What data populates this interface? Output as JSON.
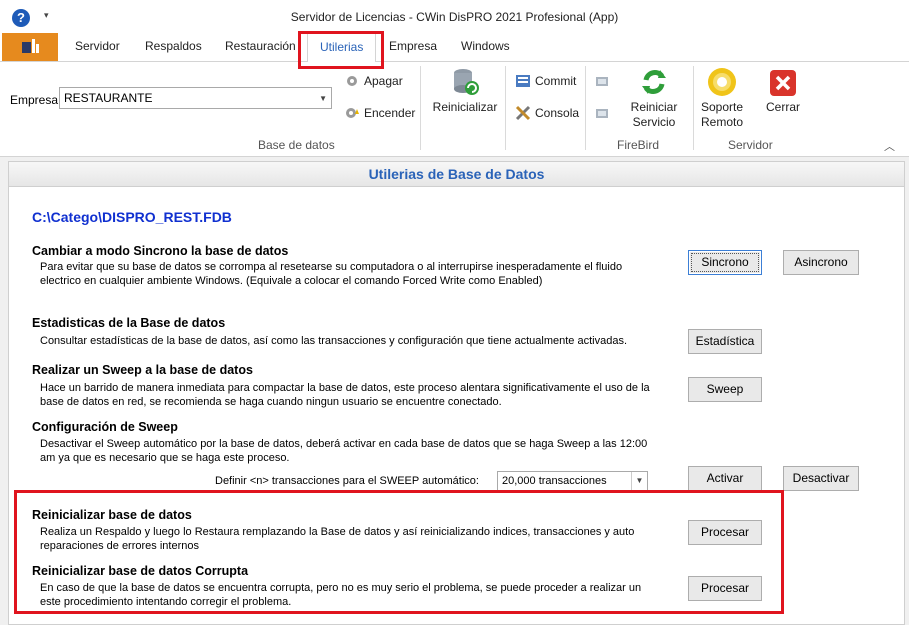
{
  "window": {
    "title": "Servidor de Licencias - CWin DisPRO 2021 Profesional (App)",
    "help_glyph": "?",
    "qa_glyph": "▾"
  },
  "tabs": [
    {
      "label": "Servidor"
    },
    {
      "label": "Respaldos"
    },
    {
      "label": "Restauración"
    },
    {
      "label": "Utilerias",
      "active": true
    },
    {
      "label": "Empresa"
    },
    {
      "label": "Windows"
    }
  ],
  "ribbon": {
    "empresa_label": "Empresa",
    "empresa_value": "RESTAURANTE",
    "apagar": "Apagar",
    "encender": "Encender",
    "reinicializar": "Reinicializar",
    "commit": "Commit",
    "consola": "Consola",
    "reiniciar_servicio_1": "Reiniciar",
    "reiniciar_servicio_2": "Servicio",
    "soporte_1": "Soporte",
    "soporte_2": "Remoto",
    "cerrar": "Cerrar",
    "group_base": "Base de datos",
    "group_firebird": "FireBird",
    "group_servidor": "Servidor",
    "collapse_glyph": "︿"
  },
  "panel": {
    "header": "Utilerias de Base de Datos",
    "db_path": "C:\\Catego\\DISPRO_REST.FDB",
    "sections": {
      "sincrono": {
        "title": "Cambiar a modo Sincrono la base de datos",
        "desc": "Para evitar que su base de datos se corrompa al resetearse su computadora o al interrupirse inesperadamente el fluido electrico en cualquier ambiente Windows. (Equivale a colocar el comando Forced Write como Enabled)",
        "btn_sincrono": "Sincrono",
        "btn_asincrono": "Asincrono"
      },
      "estadisticas": {
        "title": "Estadisticas de la Base de datos",
        "desc": "Consultar estadísticas de la base de datos, así como las transacciones y configuración que tiene actualmente activadas.",
        "btn": "Estadística"
      },
      "sweep": {
        "title": "Realizar un Sweep a la base de datos",
        "desc": "Hace un barrido de manera inmediata para compactar la base de datos, este proceso alentara significativamente el uso de la base de datos en red, se recomienda se haga cuando ningun usuario se encuentre conectado.",
        "btn": "Sweep"
      },
      "config_sweep": {
        "title": "Configuración de Sweep",
        "desc": "Desactivar el Sweep automático por la base de datos, deberá activar en cada base de datos que se haga Sweep a las 12:00 am ya que es necesario que se haga este proceso.",
        "label": "Definir <n> transacciones para el SWEEP automático:",
        "combo_value": "20,000 transacciones",
        "btn_activar": "Activar",
        "btn_desactivar": "Desactivar"
      },
      "reinicializar": {
        "title": "Reinicializar base de datos",
        "desc": "Realiza un Respaldo y luego lo Restaura remplazando la Base de datos y así reinicializando indices, transacciones y auto reparaciones de errores internos",
        "btn": "Procesar"
      },
      "corrupta": {
        "title": "Reinicializar base de datos Corrupta",
        "desc": "En caso de que la base de datos se encuentra corrupta, pero no es muy serio el problema, se puede proceder a realizar un este procedimiento intentando corregir el problema.",
        "btn": "Procesar"
      }
    }
  },
  "colors": {
    "accent": "#2a63b8",
    "app_button": "#e68a1e",
    "highlight": "#e0141e",
    "path_link": "#1030d0"
  }
}
